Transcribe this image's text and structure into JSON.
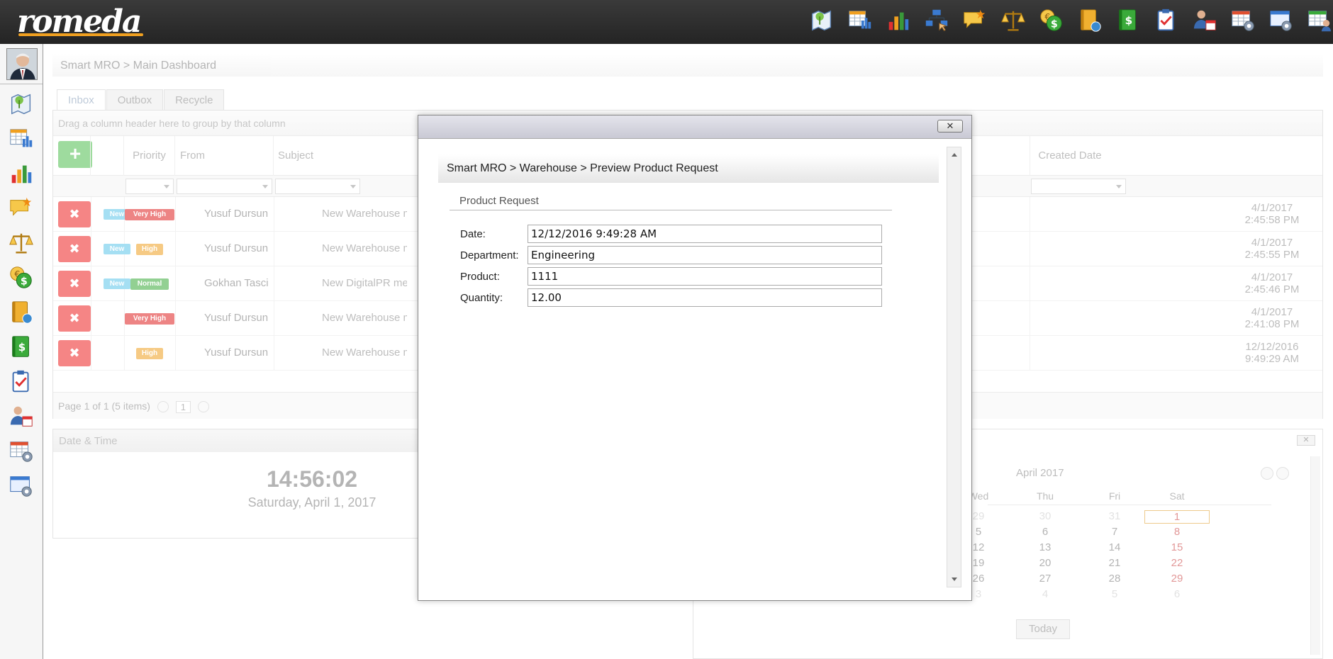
{
  "app": {
    "logo": "romeda"
  },
  "topbar": {
    "icons": [
      "map-icon",
      "table-chart-icon",
      "bar-chart-icon",
      "org-chart-icon",
      "chat-icon",
      "scale-icon",
      "currency-exchange-icon",
      "address-book-icon",
      "money-book-icon",
      "clipboard-check-icon",
      "user-calendar-icon",
      "table-settings-icon",
      "window-settings-icon",
      "table-user-icon"
    ]
  },
  "sidebar": {
    "icons": [
      "map-icon",
      "table-chart-icon",
      "bar-chart-icon",
      "chat-icon",
      "scale-icon",
      "currency-exchange-icon",
      "address-book-icon",
      "money-book-icon",
      "clipboard-check-icon",
      "user-calendar-icon",
      "table-settings-icon",
      "window-settings-icon"
    ]
  },
  "dashboard": {
    "breadcrumb": "Smart MRO > Main Dashboard",
    "tabs": [
      {
        "label": "Inbox",
        "active": true
      },
      {
        "label": "Outbox",
        "active": false
      },
      {
        "label": "Recycle",
        "active": false
      }
    ],
    "grid": {
      "group_hint": "Drag a column header here to group by that column",
      "columns": {
        "priority": "Priority",
        "from": "From",
        "subject": "Subject",
        "created": "Created Date"
      },
      "add_label": "+",
      "delete_label": "✖",
      "rows": [
        {
          "status": "New",
          "priority": "Very High",
          "priority_color": "#e02020",
          "from": "Yusuf Dursun",
          "subject": "New Warehouse message",
          "created_date": "4/1/2017",
          "created_time": "2:45:58 PM"
        },
        {
          "status": "New",
          "priority": "High",
          "priority_color": "#f0a020",
          "from": "Yusuf Dursun",
          "subject": "New Warehouse message",
          "created_date": "4/1/2017",
          "created_time": "2:45:55 PM"
        },
        {
          "status": "New",
          "priority": "Normal",
          "priority_color": "#3aaa3a",
          "from": "Gokhan Tasci",
          "subject": "New DigitalPR message",
          "created_date": "4/1/2017",
          "created_time": "2:45:46 PM"
        },
        {
          "status": "",
          "priority": "Very High",
          "priority_color": "#e02020",
          "from": "Yusuf Dursun",
          "subject": "New Warehouse message",
          "created_date": "4/1/2017",
          "created_time": "2:41:08 PM"
        },
        {
          "status": "",
          "priority": "High",
          "priority_color": "#f0a020",
          "from": "Yusuf Dursun",
          "subject": "New Warehouse message",
          "created_date": "12/12/2016",
          "created_time": "9:49:29 AM"
        }
      ],
      "pager": {
        "text": "Page 1 of 1 (5 items)",
        "page": "1"
      }
    },
    "datetime": {
      "title": "Date & Time",
      "time": "14:56:02",
      "date": "Saturday, April 1, 2017"
    },
    "calendar": {
      "month": "April 2017",
      "close_label": "✕",
      "dow": [
        "Wed",
        "Thu",
        "Fri",
        "Sat"
      ],
      "weeks": [
        [
          "29",
          "30",
          "31",
          "1"
        ],
        [
          "5",
          "6",
          "7",
          "8"
        ],
        [
          "12",
          "13",
          "14",
          "15"
        ],
        [
          "19",
          "20",
          "21",
          "22"
        ],
        [
          "26",
          "27",
          "28",
          "29"
        ],
        [
          "3",
          "4",
          "5",
          "6"
        ]
      ],
      "today_label": "Today"
    }
  },
  "modal": {
    "close_label": "✕",
    "breadcrumb": "Smart MRO > Warehouse > Preview Product Request",
    "form_title": "Product Request",
    "fields": [
      {
        "label": "Date:",
        "value": "12/12/2016 9:49:28 AM"
      },
      {
        "label": "Department:",
        "value": "Engineering"
      },
      {
        "label": "Product:",
        "value": "1111"
      },
      {
        "label": "Quantity:",
        "value": "12.00"
      }
    ]
  }
}
